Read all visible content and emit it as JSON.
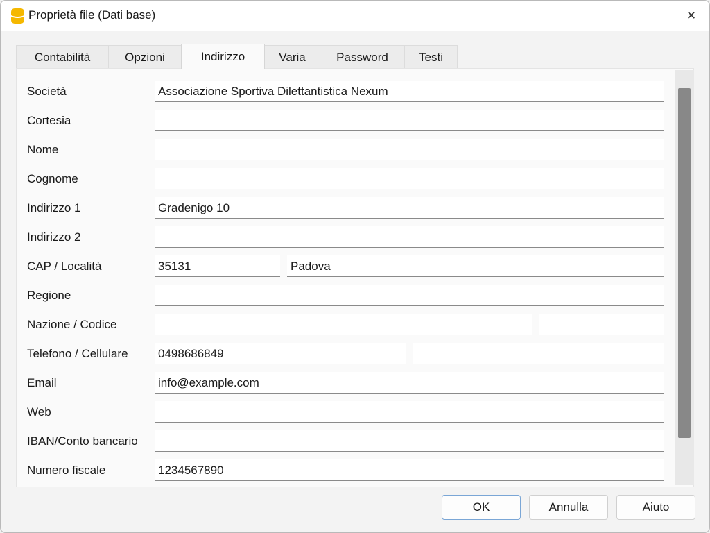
{
  "window": {
    "title": "Proprietà file (Dati base)",
    "close_label": "✕"
  },
  "tabs": [
    {
      "label": "Contabilità",
      "active": false
    },
    {
      "label": "Opzioni",
      "active": false
    },
    {
      "label": "Indirizzo",
      "active": true
    },
    {
      "label": "Varia",
      "active": false
    },
    {
      "label": "Password",
      "active": false
    },
    {
      "label": "Testi",
      "active": false
    }
  ],
  "fields": {
    "societa": {
      "label": "Società",
      "value": "Associazione Sportiva Dilettantistica Nexum"
    },
    "cortesia": {
      "label": "Cortesia",
      "value": ""
    },
    "nome": {
      "label": "Nome",
      "value": ""
    },
    "cognome": {
      "label": "Cognome",
      "value": ""
    },
    "indirizzo1": {
      "label": "Indirizzo 1",
      "value": "Gradenigo 10"
    },
    "indirizzo2": {
      "label": "Indirizzo 2",
      "value": ""
    },
    "cap_localita": {
      "label": "CAP / Località",
      "cap": "35131",
      "localita": "Padova"
    },
    "regione": {
      "label": "Regione",
      "value": ""
    },
    "nazione_codice": {
      "label": "Nazione / Codice",
      "nazione": "",
      "codice": ""
    },
    "telefono_cellulare": {
      "label": "Telefono / Cellulare",
      "telefono": "0498686849",
      "cellulare": ""
    },
    "email": {
      "label": "Email",
      "value": "info@example.com"
    },
    "web": {
      "label": "Web",
      "value": ""
    },
    "iban": {
      "label": "IBAN/Conto bancario",
      "value": ""
    },
    "numero_fiscale": {
      "label": "Numero fiscale",
      "value": "1234567890"
    }
  },
  "buttons": {
    "ok": "OK",
    "annulla": "Annulla",
    "aiuto": "Aiuto"
  },
  "colors": {
    "app_icon": "#f5b800",
    "primary_border": "#7aa6d6"
  }
}
